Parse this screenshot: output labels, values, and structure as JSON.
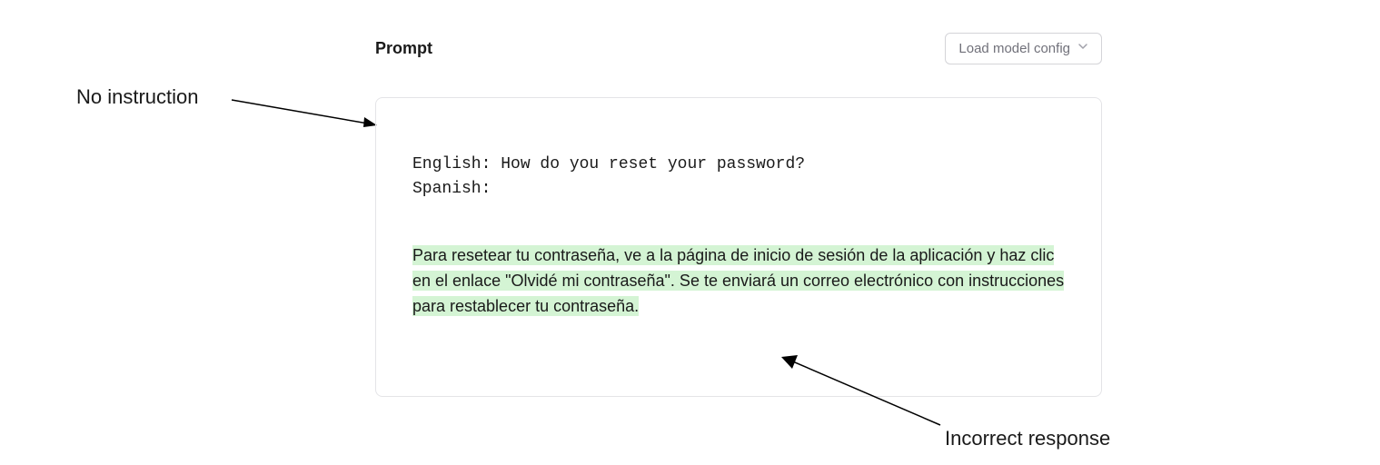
{
  "header": {
    "prompt_label": "Prompt",
    "load_config_label": "Load model config"
  },
  "annotations": {
    "no_instruction": "No instruction",
    "incorrect_response": "Incorrect response"
  },
  "prompt_content": {
    "line1": "English: How do you reset your password?",
    "line2": "Spanish:",
    "response": "Para resetear tu contraseña, ve a la página de inicio de sesión de la aplicación y haz clic en el enlace \"Olvidé mi contraseña\". Se te enviará un correo electrónico con instrucciones para restablecer tu contraseña."
  }
}
